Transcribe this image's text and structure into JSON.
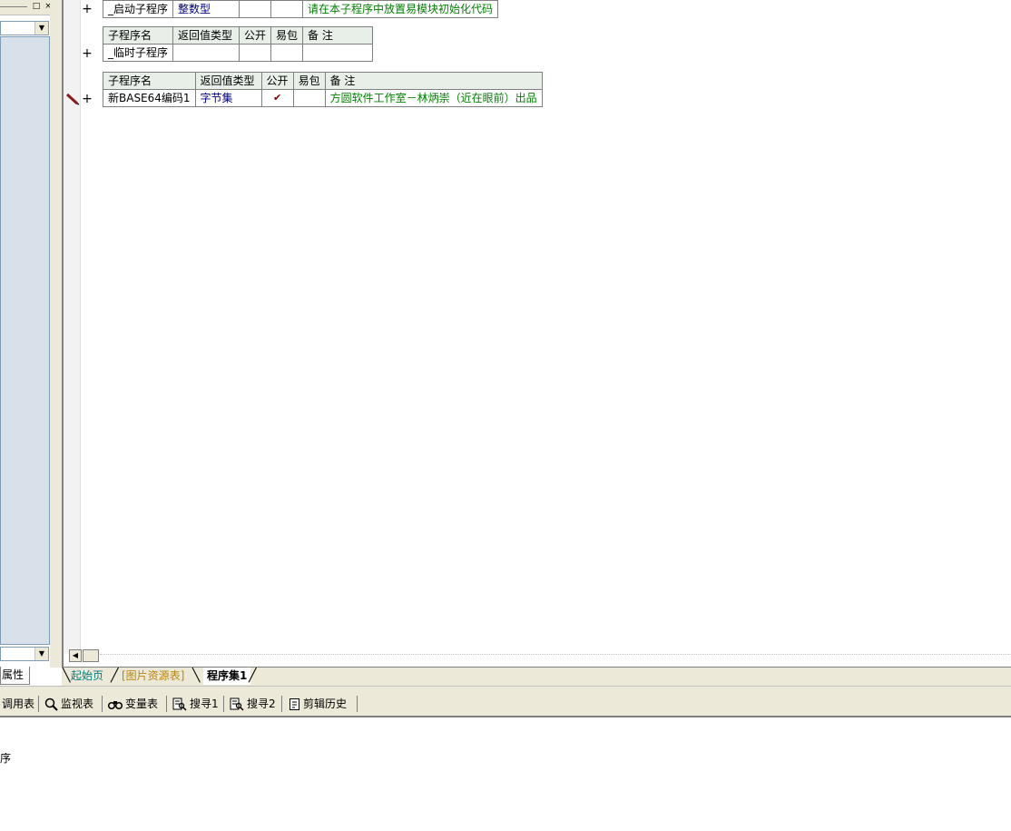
{
  "tables": [
    {
      "rows": [
        {
          "name": "_启动子程序",
          "type": "整数型",
          "public": "",
          "pkg": "",
          "note": "请在本子程序中放置易模块初始化代码"
        }
      ]
    },
    {
      "headers": [
        "子程序名",
        "返回值类型",
        "公开",
        "易包",
        "备 注"
      ],
      "rows": [
        {
          "name": "_临时子程序",
          "type": "",
          "public": "",
          "pkg": "",
          "note": ""
        }
      ]
    },
    {
      "headers": [
        "子程序名",
        "返回值类型",
        "公开",
        "易包",
        "备 注"
      ],
      "rows": [
        {
          "name": "新BASE64编码1",
          "type": "字节集",
          "public": "✔",
          "pkg": "",
          "note": "方圆软件工作室－林炳崇（近在眼前）出品"
        }
      ]
    }
  ],
  "gutter_marks": [
    "+",
    "+",
    "+"
  ],
  "left_panel": {
    "tab_label": "属性"
  },
  "editor_tabs": [
    {
      "label": "起始页"
    },
    {
      "label": "[图片资源表]"
    },
    {
      "label": "程序集1"
    }
  ],
  "bottom_toolbar": [
    {
      "label": "调用表",
      "icon": "call-table-icon"
    },
    {
      "label": "监视表",
      "icon": "magnifier-icon"
    },
    {
      "label": "变量表",
      "icon": "binoculars-icon"
    },
    {
      "label": "搜寻1",
      "icon": "search-doc-icon"
    },
    {
      "label": "搜寻2",
      "icon": "search-doc-icon"
    },
    {
      "label": "剪辑历史",
      "icon": "clipboard-history-icon"
    }
  ],
  "output_text": "序",
  "colors": {
    "name": "#000000",
    "type": "#000080",
    "note": "#008000",
    "header_bg": "#e8efe8",
    "left_panel_bg": "#d8e0ea",
    "tab_start": "#008080",
    "tab_image_res": "#b8860b"
  }
}
